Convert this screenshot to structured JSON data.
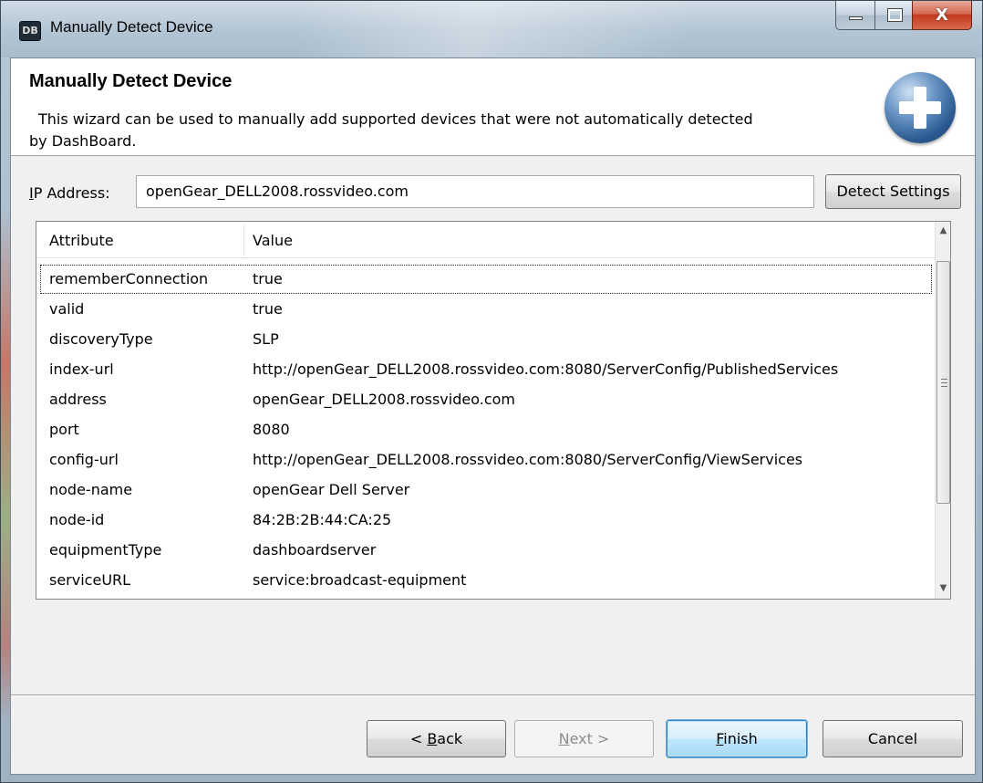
{
  "window": {
    "title": "Manually Detect Device",
    "app_icon_text": "DB",
    "icons": {
      "minimize": "minimize-icon",
      "maximize": "maximize-icon",
      "close": "close-icon"
    },
    "close_glyph": "X"
  },
  "wizard": {
    "title": "Manually Detect Device",
    "description_line1": "This wizard can be used to manually add supported devices that were not automatically detected",
    "description_line2": "by DashBoard.",
    "icon": "add-icon"
  },
  "ip": {
    "label_mnemonic": "I",
    "label_rest": "P Address:",
    "value": "openGear_DELL2008.rossvideo.com",
    "detect_button": "Detect Settings"
  },
  "table": {
    "columns": [
      "Attribute",
      "Value"
    ],
    "rows": [
      {
        "attribute": "rememberConnection",
        "value": "true"
      },
      {
        "attribute": "valid",
        "value": "true"
      },
      {
        "attribute": "discoveryType",
        "value": "SLP"
      },
      {
        "attribute": "index-url",
        "value": "http://openGear_DELL2008.rossvideo.com:8080/ServerConfig/PublishedServices"
      },
      {
        "attribute": "address",
        "value": "openGear_DELL2008.rossvideo.com"
      },
      {
        "attribute": "port",
        "value": "8080"
      },
      {
        "attribute": "config-url",
        "value": "http://openGear_DELL2008.rossvideo.com:8080/ServerConfig/ViewServices"
      },
      {
        "attribute": "node-name",
        "value": "openGear Dell Server"
      },
      {
        "attribute": "node-id",
        "value": "84:2B:2B:44:CA:25"
      },
      {
        "attribute": "equipmentType",
        "value": "dashboardserver"
      },
      {
        "attribute": "serviceURL",
        "value": "service:broadcast-equipment"
      }
    ]
  },
  "buttons": {
    "back_prefix": "< ",
    "back_mnemonic": "B",
    "back_rest": "ack",
    "next_mnemonic": "N",
    "next_rest": "ext >",
    "finish_mnemonic": "F",
    "finish_rest": "inish",
    "cancel": "Cancel"
  },
  "colors": {
    "window_frame": "#a9bccb",
    "client_bg": "#f0f0f0",
    "finish_highlight": "#bee6fd",
    "close_button": "#c23a20"
  }
}
